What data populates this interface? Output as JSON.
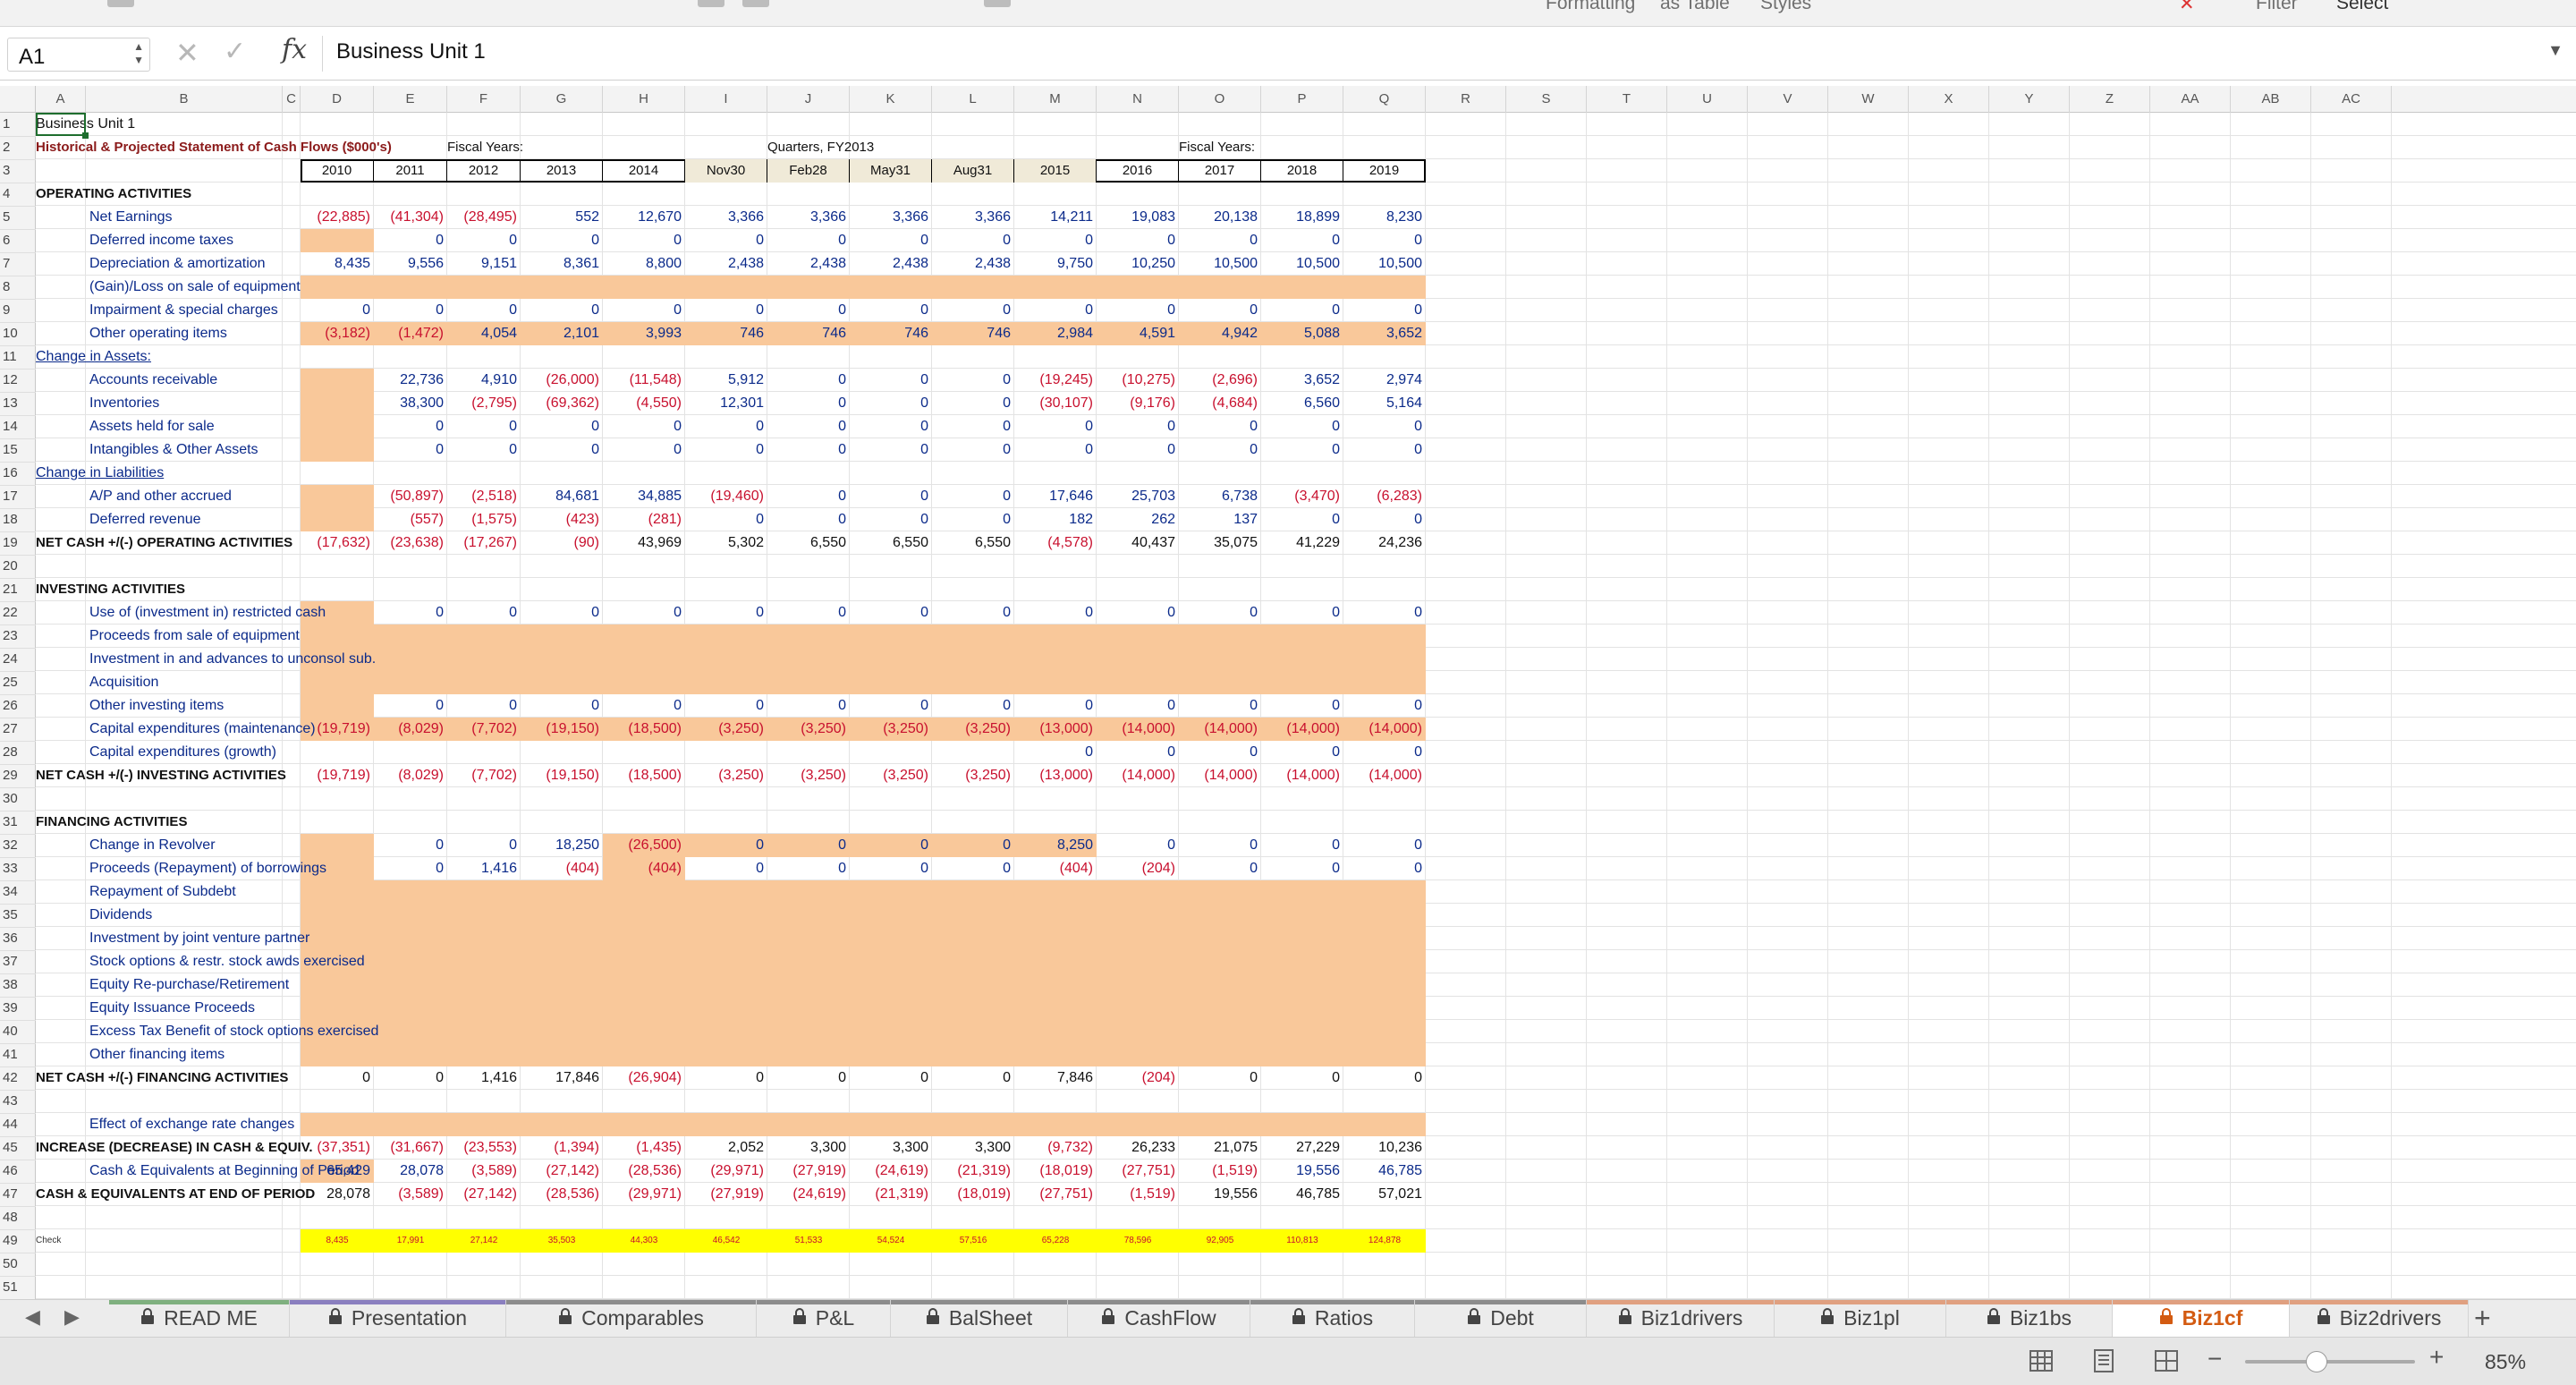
{
  "ribbon": {
    "labels": [
      "Formatting",
      "as Table",
      "Styles",
      "Filter",
      "Select"
    ]
  },
  "formula_bar": {
    "name_box": "A1",
    "fx": "fx",
    "content": "Business Unit 1"
  },
  "columns": [
    "A",
    "B",
    "C",
    "D",
    "E",
    "F",
    "G",
    "H",
    "I",
    "J",
    "K",
    "L",
    "M",
    "N",
    "O",
    "P",
    "Q",
    "R",
    "S",
    "T",
    "U",
    "V",
    "W",
    "X",
    "Y",
    "Z",
    "AA",
    "AB",
    "AC"
  ],
  "sheet": {
    "title": "Business Unit 1",
    "subtitle": "Historical & Projected Statement of Cash Flows ($000's)",
    "group_fiscal": "Fiscal Years:",
    "group_quarters": "Quarters, FY2013",
    "group_fiscal2": "Fiscal Years:",
    "periods": [
      "2010",
      "2011",
      "2012",
      "2013",
      "2014",
      "Nov30",
      "Feb28",
      "May31",
      "Aug31",
      "2015",
      "2016",
      "2017",
      "2018",
      "2019"
    ],
    "rows": [
      {
        "r": 4,
        "a": "OPERATING ACTIVITIES",
        "style": "sec"
      },
      {
        "r": 5,
        "b": "Net Earnings",
        "v": [
          "(22,885)",
          "(41,304)",
          "(28,495)",
          "552",
          "12,670",
          "3,366",
          "3,366",
          "3,366",
          "3,366",
          "14,211",
          "19,083",
          "20,138",
          "18,899",
          "8,230"
        ]
      },
      {
        "r": 6,
        "b": "Deferred income taxes",
        "v": [
          "",
          "0",
          "0",
          "0",
          "0",
          "0",
          "0",
          "0",
          "0",
          "0",
          "0",
          "0",
          "0",
          "0"
        ]
      },
      {
        "r": 7,
        "b": "Depreciation & amortization",
        "v": [
          "8,435",
          "9,556",
          "9,151",
          "8,361",
          "8,800",
          "2,438",
          "2,438",
          "2,438",
          "2,438",
          "9,750",
          "10,250",
          "10,500",
          "10,500",
          "10,500"
        ]
      },
      {
        "r": 8,
        "b": "(Gain)/Loss on sale of equipment",
        "v": []
      },
      {
        "r": 9,
        "b": "Impairment & special charges",
        "v": [
          "0",
          "0",
          "0",
          "0",
          "0",
          "0",
          "0",
          "0",
          "0",
          "0",
          "0",
          "0",
          "0",
          "0"
        ]
      },
      {
        "r": 10,
        "b": "Other operating items",
        "v": [
          "(3,182)",
          "(1,472)",
          "4,054",
          "2,101",
          "3,993",
          "746",
          "746",
          "746",
          "746",
          "2,984",
          "4,591",
          "4,942",
          "5,088",
          "3,652"
        ]
      },
      {
        "r": 11,
        "a": "Change in Assets:",
        "style": "ul"
      },
      {
        "r": 12,
        "b": "Accounts receivable",
        "v": [
          "",
          "22,736",
          "4,910",
          "(26,000)",
          "(11,548)",
          "5,912",
          "0",
          "0",
          "0",
          "(19,245)",
          "(10,275)",
          "(2,696)",
          "3,652",
          "2,974"
        ]
      },
      {
        "r": 13,
        "b": "Inventories",
        "v": [
          "",
          "38,300",
          "(2,795)",
          "(69,362)",
          "(4,550)",
          "12,301",
          "0",
          "0",
          "0",
          "(30,107)",
          "(9,176)",
          "(4,684)",
          "6,560",
          "5,164"
        ]
      },
      {
        "r": 14,
        "b": "Assets held for sale",
        "v": [
          "",
          "0",
          "0",
          "0",
          "0",
          "0",
          "0",
          "0",
          "0",
          "0",
          "0",
          "0",
          "0",
          "0"
        ]
      },
      {
        "r": 15,
        "b": "Intangibles & Other Assets",
        "v": [
          "",
          "0",
          "0",
          "0",
          "0",
          "0",
          "0",
          "0",
          "0",
          "0",
          "0",
          "0",
          "0",
          "0"
        ]
      },
      {
        "r": 16,
        "a": "Change in Liabilities",
        "style": "ul"
      },
      {
        "r": 17,
        "b": "A/P and other accrued",
        "v": [
          "",
          "(50,897)",
          "(2,518)",
          "84,681",
          "34,885",
          "(19,460)",
          "0",
          "0",
          "0",
          "17,646",
          "25,703",
          "6,738",
          "(3,470)",
          "(6,283)"
        ]
      },
      {
        "r": 18,
        "b": "Deferred revenue",
        "v": [
          "",
          "(557)",
          "(1,575)",
          "(423)",
          "(281)",
          "0",
          "0",
          "0",
          "0",
          "182",
          "262",
          "137",
          "0",
          "0"
        ]
      },
      {
        "r": 19,
        "a": "NET CASH +/(-) OPERATING ACTIVITIES",
        "style": "sec",
        "v": [
          "(17,632)",
          "(23,638)",
          "(17,267)",
          "(90)",
          "43,969",
          "5,302",
          "6,550",
          "6,550",
          "6,550",
          "(4,578)",
          "40,437",
          "35,075",
          "41,229",
          "24,236"
        ]
      },
      {
        "r": 21,
        "a": "INVESTING ACTIVITIES",
        "style": "sec"
      },
      {
        "r": 22,
        "b": "Use of (investment in) restricted cash",
        "v": [
          "",
          "0",
          "0",
          "0",
          "0",
          "0",
          "0",
          "0",
          "0",
          "0",
          "0",
          "0",
          "0",
          "0"
        ]
      },
      {
        "r": 23,
        "b": "Proceeds from sale of equipment",
        "v": []
      },
      {
        "r": 24,
        "b": "Investment in and advances to unconsol sub.",
        "v": []
      },
      {
        "r": 25,
        "b": "Acquisition",
        "v": []
      },
      {
        "r": 26,
        "b": "Other investing items",
        "v": [
          "",
          "0",
          "0",
          "0",
          "0",
          "0",
          "0",
          "0",
          "0",
          "0",
          "0",
          "0",
          "0",
          "0"
        ]
      },
      {
        "r": 27,
        "b": "Capital expenditures (maintenance)",
        "v": [
          "(19,719)",
          "(8,029)",
          "(7,702)",
          "(19,150)",
          "(18,500)",
          "(3,250)",
          "(3,250)",
          "(3,250)",
          "(3,250)",
          "(13,000)",
          "(14,000)",
          "(14,000)",
          "(14,000)",
          "(14,000)"
        ]
      },
      {
        "r": 28,
        "b": "Capital expenditures (growth)",
        "v": [
          "",
          "",
          "",
          "",
          "",
          "",
          "",
          "",
          "",
          "0",
          "0",
          "0",
          "0",
          "0"
        ]
      },
      {
        "r": 29,
        "a": "NET CASH +/(-) INVESTING ACTIVITIES",
        "style": "sec",
        "v": [
          "(19,719)",
          "(8,029)",
          "(7,702)",
          "(19,150)",
          "(18,500)",
          "(3,250)",
          "(3,250)",
          "(3,250)",
          "(3,250)",
          "(13,000)",
          "(14,000)",
          "(14,000)",
          "(14,000)",
          "(14,000)"
        ]
      },
      {
        "r": 31,
        "a": "FINANCING ACTIVITIES",
        "style": "sec"
      },
      {
        "r": 32,
        "b": "Change in Revolver",
        "v": [
          "",
          "0",
          "0",
          "18,250",
          "(26,500)",
          "0",
          "0",
          "0",
          "0",
          "8,250",
          "0",
          "0",
          "0",
          "0"
        ]
      },
      {
        "r": 33,
        "b": "Proceeds (Repayment) of borrowings",
        "v": [
          "",
          "0",
          "1,416",
          "(404)",
          "(404)",
          "0",
          "0",
          "0",
          "0",
          "(404)",
          "(204)",
          "0",
          "0",
          "0"
        ]
      },
      {
        "r": 34,
        "b": "Repayment of Subdebt",
        "v": []
      },
      {
        "r": 35,
        "b": "Dividends",
        "v": []
      },
      {
        "r": 36,
        "b": "Investment by joint venture partner",
        "v": []
      },
      {
        "r": 37,
        "b": "Stock options & restr. stock awds exercised",
        "v": []
      },
      {
        "r": 38,
        "b": "Equity Re-purchase/Retirement",
        "v": []
      },
      {
        "r": 39,
        "b": "Equity Issuance Proceeds",
        "v": []
      },
      {
        "r": 40,
        "b": "Excess Tax Benefit of stock options exercised",
        "v": []
      },
      {
        "r": 41,
        "b": "Other financing items",
        "v": []
      },
      {
        "r": 42,
        "a": "NET CASH +/(-) FINANCING ACTIVITIES",
        "style": "sec",
        "v": [
          "0",
          "0",
          "1,416",
          "17,846",
          "(26,904)",
          "0",
          "0",
          "0",
          "0",
          "7,846",
          "(204)",
          "0",
          "0",
          "0"
        ]
      },
      {
        "r": 44,
        "b": "Effect of exchange rate changes",
        "v": []
      },
      {
        "r": 45,
        "a": "INCREASE (DECREASE) IN CASH & EQUIV.",
        "style": "sec",
        "v": [
          "(37,351)",
          "(31,667)",
          "(23,553)",
          "(1,394)",
          "(1,435)",
          "2,052",
          "3,300",
          "3,300",
          "3,300",
          "(9,732)",
          "26,233",
          "21,075",
          "27,229",
          "10,236"
        ]
      },
      {
        "r": 46,
        "b": "Cash & Equivalents at Beginning of Period",
        "v": [
          "65,429",
          "28,078",
          "(3,589)",
          "(27,142)",
          "(28,536)",
          "(29,971)",
          "(27,919)",
          "(24,619)",
          "(21,319)",
          "(18,019)",
          "(27,751)",
          "(1,519)",
          "19,556",
          "46,785"
        ]
      },
      {
        "r": 47,
        "a": "CASH & EQUIVALENTS AT END OF PERIOD",
        "style": "sec",
        "v": [
          "28,078",
          "(3,589)",
          "(27,142)",
          "(28,536)",
          "(29,971)",
          "(27,919)",
          "(24,619)",
          "(21,319)",
          "(18,019)",
          "(27,751)",
          "(1,519)",
          "19,556",
          "46,785",
          "57,021"
        ]
      },
      {
        "r": 49,
        "a": "Check",
        "style": "tiny",
        "v": [
          "8,435",
          "17,991",
          "27,142",
          "35,503",
          "44,303",
          "46,542",
          "51,533",
          "54,524",
          "57,516",
          "65,228",
          "78,596",
          "92,905",
          "110,813",
          "124,878"
        ]
      }
    ]
  },
  "tabs": [
    {
      "label": "READ ME",
      "color": "#7fb07f"
    },
    {
      "label": "Presentation",
      "color": "#8a7fbf"
    },
    {
      "label": "Comparables",
      "color": "#8c8c8c"
    },
    {
      "label": "P&L",
      "color": "#8c8c8c"
    },
    {
      "label": "BalSheet",
      "color": "#8c8c8c"
    },
    {
      "label": "CashFlow",
      "color": "#8c8c8c"
    },
    {
      "label": "Ratios",
      "color": "#8c8c8c"
    },
    {
      "label": "Debt",
      "color": "#8c8c8c"
    },
    {
      "label": "Biz1drivers",
      "color": "#e0a080"
    },
    {
      "label": "Biz1pl",
      "color": "#e0a080"
    },
    {
      "label": "Biz1bs",
      "color": "#e0a080"
    },
    {
      "label": "Biz1cf",
      "color": "#e0a080",
      "active": true
    },
    {
      "label": "Biz2drivers",
      "color": "#e0a080"
    }
  ],
  "status": {
    "zoom": "85%"
  },
  "colors": {
    "input_fill": "#f9c89a",
    "check_fill": "#ffff00",
    "negative": "#c8102e",
    "positive": "#0b2a8a",
    "active_tab": "#d35b12"
  }
}
